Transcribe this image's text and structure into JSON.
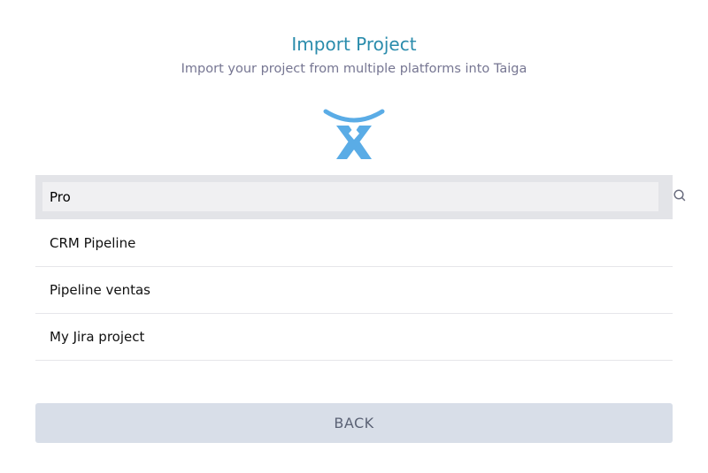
{
  "header": {
    "title": "Import Project",
    "subtitle": "Import your project from multiple platforms into Taiga"
  },
  "platform": {
    "logo_icon": "atlassian-jira-icon",
    "brand_color": "#5aace6"
  },
  "search": {
    "value": "Pro",
    "icon": "search-icon"
  },
  "results": [
    {
      "label": "CRM Pipeline"
    },
    {
      "label": "Pipeline ventas"
    },
    {
      "label": "My Jira project"
    }
  ],
  "footer": {
    "back_label": "BACK"
  },
  "colors": {
    "accent": "#2a8cac",
    "button_bg": "#d8dee8",
    "search_bg": "#e3e4e8"
  }
}
